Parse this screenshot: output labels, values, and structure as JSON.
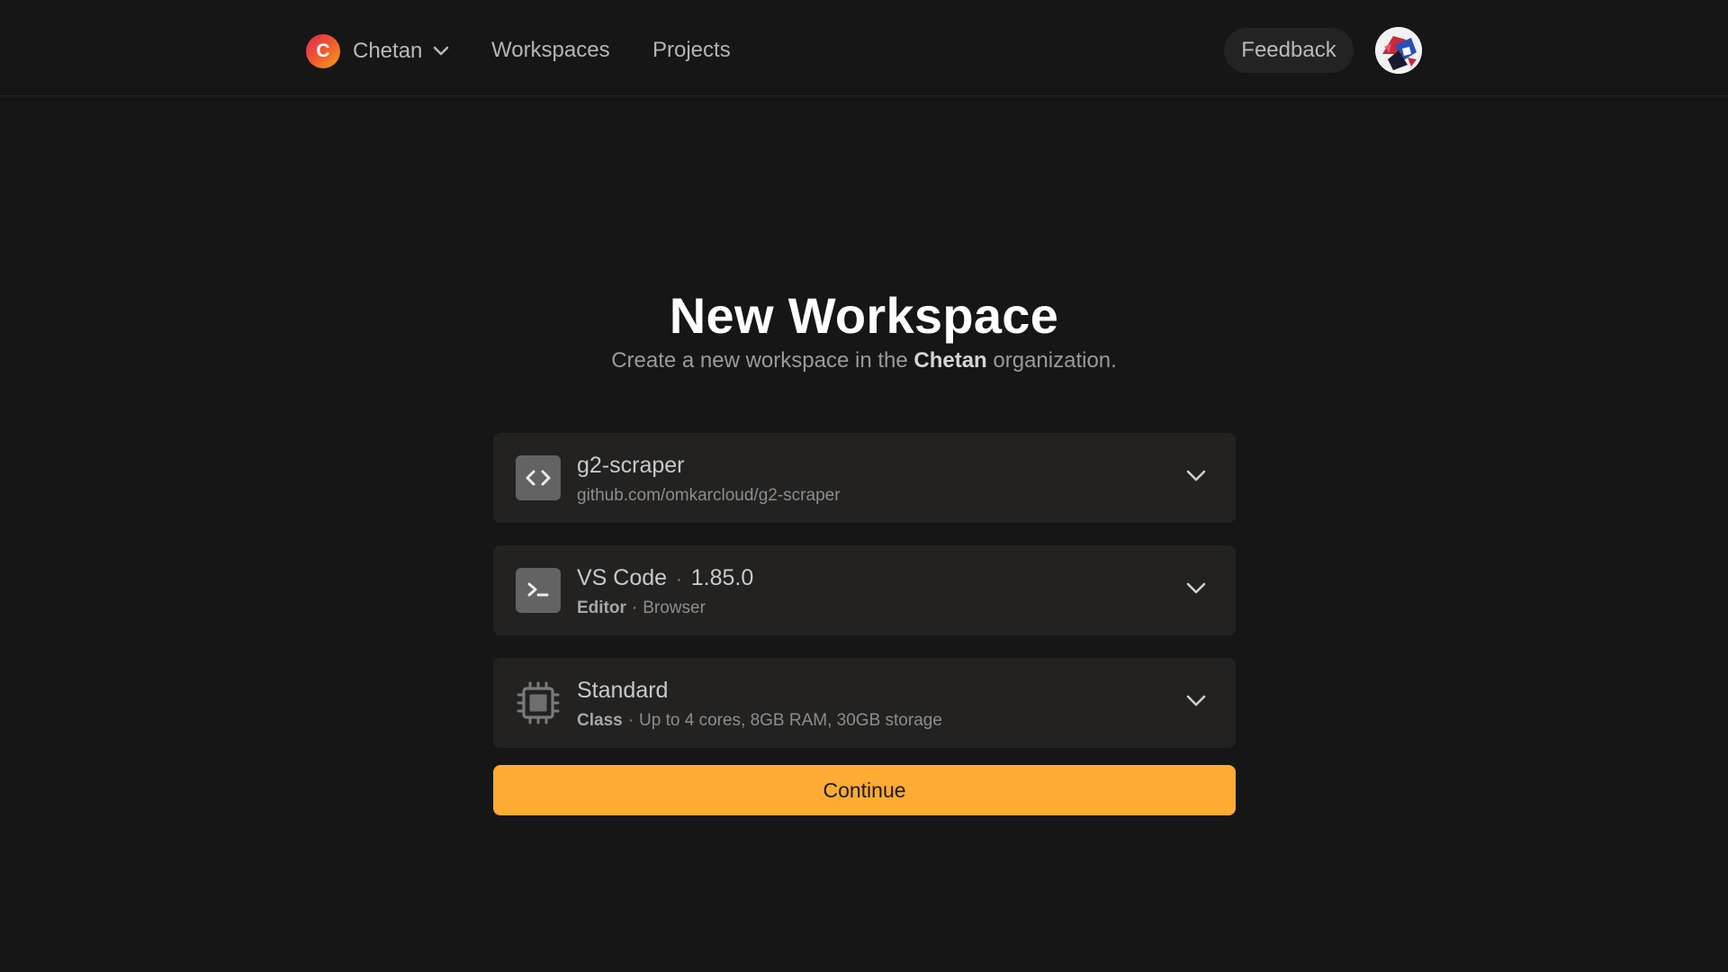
{
  "nav": {
    "org_initial": "C",
    "org_name": "Chetan",
    "links": [
      "Workspaces",
      "Projects"
    ],
    "feedback_label": "Feedback"
  },
  "header": {
    "title": "New Workspace",
    "subtitle_prefix": "Create a new workspace in the ",
    "subtitle_org": "Chetan",
    "subtitle_suffix": " organization."
  },
  "options": {
    "repository": {
      "icon": "code-icon",
      "title": "g2-scraper",
      "subtitle": "github.com/omkarcloud/g2-scraper"
    },
    "editor": {
      "icon": "terminal-icon",
      "title": "VS Code",
      "separator": "·",
      "version": "1.85.0",
      "sub_label": "Editor",
      "sub_separator": "·",
      "sub_value": "Browser"
    },
    "workspace_class": {
      "icon": "cpu-chip-icon",
      "title": "Standard",
      "sub_label": "Class",
      "sub_separator": "·",
      "sub_value": "Up to 4 cores, 8GB RAM, 30GB storage"
    }
  },
  "actions": {
    "continue_label": "Continue"
  },
  "colors": {
    "background": "#161616",
    "card": "#232221",
    "accent": "#fdab32"
  }
}
